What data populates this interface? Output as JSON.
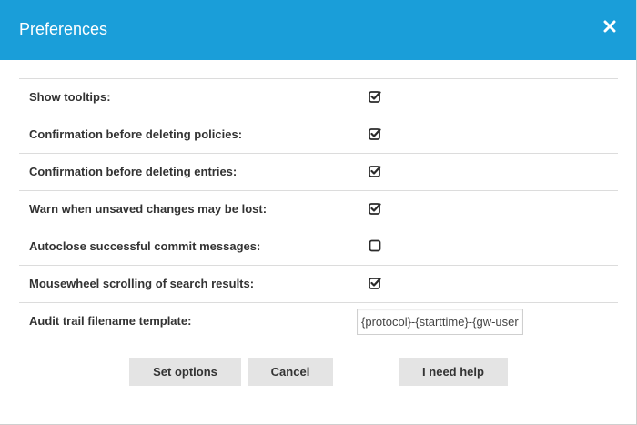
{
  "dialog": {
    "title": "Preferences",
    "close_icon": "close-icon"
  },
  "options": [
    {
      "label": "Show tooltips:",
      "checked": true
    },
    {
      "label": "Confirmation before deleting policies:",
      "checked": true
    },
    {
      "label": "Confirmation before deleting entries:",
      "checked": true
    },
    {
      "label": "Warn when unsaved changes may be lost:",
      "checked": true
    },
    {
      "label": "Autoclose successful commit messages:",
      "checked": false
    },
    {
      "label": "Mousewheel scrolling of search results:",
      "checked": true
    }
  ],
  "audit_trail": {
    "label": "Audit trail filename template:",
    "value": "{protocol}-{starttime}-{gw-username}-{remote-username}"
  },
  "buttons": {
    "set_options": "Set options",
    "cancel": "Cancel",
    "help": "I need help"
  },
  "colors": {
    "header": "#1a9ed9",
    "button_bg": "#e4e4e4"
  }
}
